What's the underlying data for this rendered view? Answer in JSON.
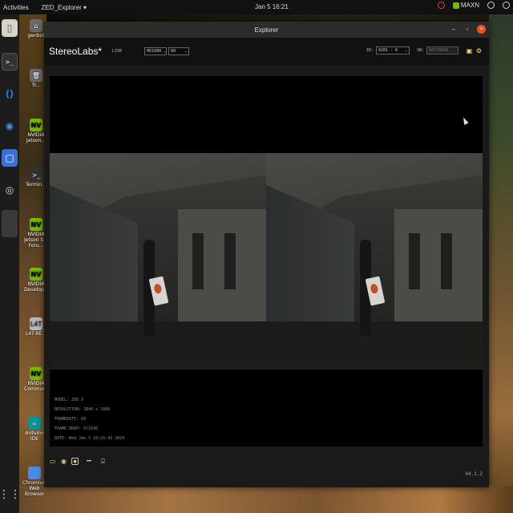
{
  "topbar": {
    "activities": "Activities",
    "app_menu": "ZED_Explorer ▾",
    "clock": "Jan 5  16:21",
    "power_mode": "MAXN"
  },
  "desktop": {
    "icons": [
      {
        "label": "genbot"
      },
      {
        "label": "Tr..."
      },
      {
        "label": "NVIDIA Jetson..."
      },
      {
        "label": "Termin..."
      },
      {
        "label": "NVIDIA Jetson S... Foru..."
      },
      {
        "label": "NVIDIA Develop..."
      },
      {
        "label": "L4T-RE..."
      },
      {
        "label": "NVIDIA Communit..."
      },
      {
        "label": "Arduino IDE"
      },
      {
        "label": "Chromium Web Browser"
      }
    ]
  },
  "window": {
    "title": "Explorer",
    "logo": "StereoLabs*",
    "mode": "LIVE",
    "resolution_select": "HD1080",
    "fps_select": "60",
    "id_label": "ID:",
    "id_select": "0201 - 0",
    "sn_label": "SN:",
    "sn_value": "40728998",
    "overlay": {
      "model": "MODEL: ZED X",
      "resolution": "RESOLUTION: 3840 x 1080",
      "framerate": "FRAMERATE: 60",
      "frame_drop": "FRAME DROP: 0/3240",
      "date": "DATE: Wed Jan 5 16:21:43 2024"
    },
    "version": "V4.1.2"
  }
}
